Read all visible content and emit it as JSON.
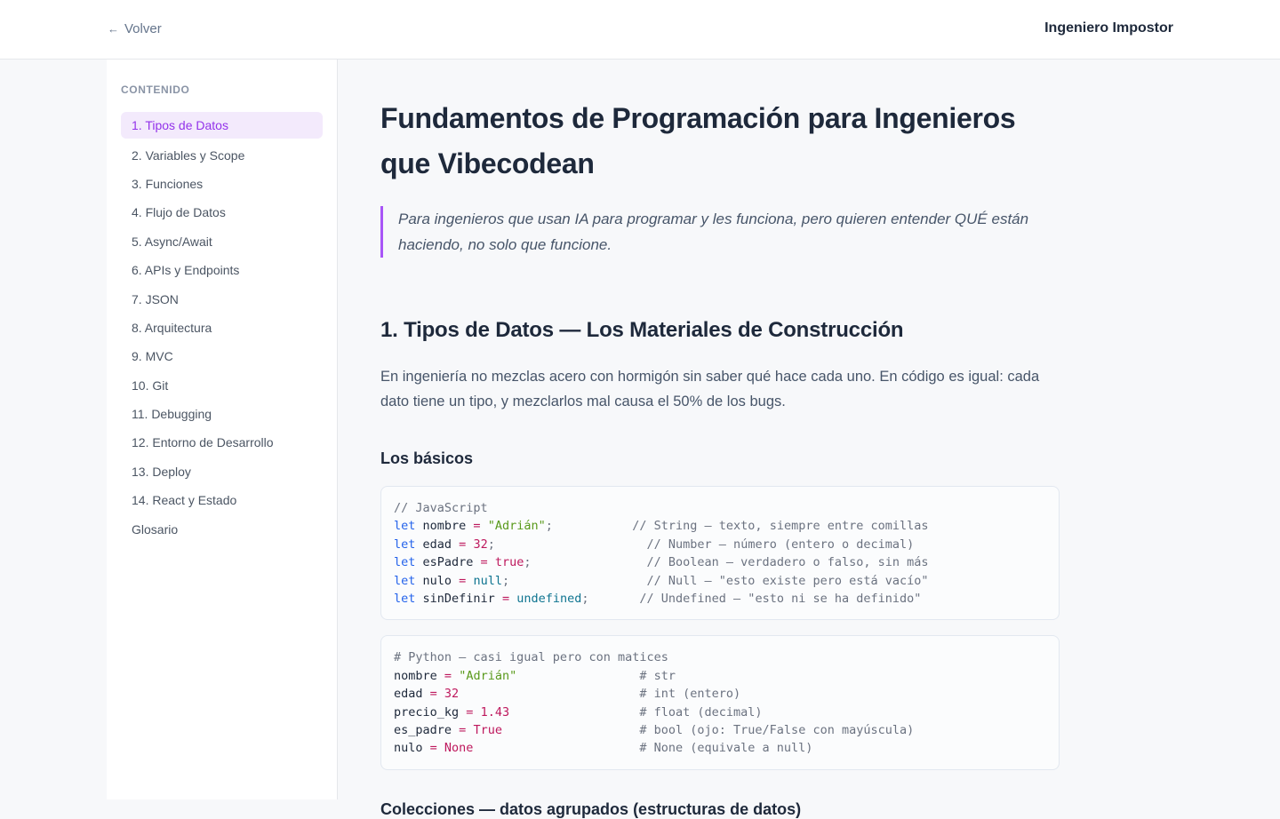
{
  "header": {
    "back_label": "Volver",
    "brand": "Ingeniero Impostor"
  },
  "sidebar": {
    "heading": "CONTENIDO",
    "items": [
      {
        "label": "1. Tipos de Datos",
        "active": true
      },
      {
        "label": "2. Variables y Scope"
      },
      {
        "label": "3. Funciones"
      },
      {
        "label": "4. Flujo de Datos"
      },
      {
        "label": "5. Async/Await"
      },
      {
        "label": "6. APIs y Endpoints"
      },
      {
        "label": "7. JSON"
      },
      {
        "label": "8. Arquitectura"
      },
      {
        "label": "9. MVC"
      },
      {
        "label": "10. Git"
      },
      {
        "label": "11. Debugging"
      },
      {
        "label": "12. Entorno de Desarrollo"
      },
      {
        "label": "13. Deploy"
      },
      {
        "label": "14. React y Estado"
      },
      {
        "label": "Glosario"
      }
    ]
  },
  "main": {
    "title": "Fundamentos de Programación para Ingenieros que Vibecodean",
    "lead": "Para ingenieros que usan IA para programar y les funciona, pero quieren entender QUÉ están haciendo, no solo que funcione.",
    "section_title": "1. Tipos de Datos — Los Materiales de Construcción",
    "section_intro": "En ingeniería no mezclas acero con hormigón sin saber qué hace cada uno. En código es igual: cada dato tiene un tipo, y mezclarlos mal causa el 50% de los bugs.",
    "subsection_title": "Los básicos",
    "code_js": [
      {
        "tokens": [
          {
            "t": "c",
            "v": "// JavaScript"
          }
        ]
      },
      {
        "tokens": [
          {
            "t": "k",
            "v": "let"
          },
          {
            "t": "p",
            "v": " nombre "
          },
          {
            "t": "n",
            "v": "="
          },
          {
            "t": "p",
            "v": " "
          },
          {
            "t": "s",
            "v": "\"Adrián\""
          },
          {
            "t": "c",
            "v": ";           // String — texto, siempre entre comillas"
          }
        ]
      },
      {
        "tokens": [
          {
            "t": "k",
            "v": "let"
          },
          {
            "t": "p",
            "v": " edad "
          },
          {
            "t": "n",
            "v": "="
          },
          {
            "t": "p",
            "v": " "
          },
          {
            "t": "n",
            "v": "32"
          },
          {
            "t": "c",
            "v": ";                     // Number — número (entero o decimal)"
          }
        ]
      },
      {
        "tokens": [
          {
            "t": "k",
            "v": "let"
          },
          {
            "t": "p",
            "v": " esPadre "
          },
          {
            "t": "n",
            "v": "="
          },
          {
            "t": "p",
            "v": " "
          },
          {
            "t": "n",
            "v": "true"
          },
          {
            "t": "c",
            "v": ";                // Boolean — verdadero o falso, sin más"
          }
        ]
      },
      {
        "tokens": [
          {
            "t": "k",
            "v": "let"
          },
          {
            "t": "p",
            "v": " nulo "
          },
          {
            "t": "n",
            "v": "="
          },
          {
            "t": "p",
            "v": " "
          },
          {
            "t": "v",
            "v": "null"
          },
          {
            "t": "c",
            "v": ";                   // Null — \"esto existe pero está vacío\""
          }
        ]
      },
      {
        "tokens": [
          {
            "t": "k",
            "v": "let"
          },
          {
            "t": "p",
            "v": " sinDefinir "
          },
          {
            "t": "n",
            "v": "="
          },
          {
            "t": "p",
            "v": " "
          },
          {
            "t": "v",
            "v": "undefined"
          },
          {
            "t": "c",
            "v": ";       // Undefined — \"esto ni se ha definido\""
          }
        ]
      }
    ],
    "code_py": [
      {
        "tokens": [
          {
            "t": "c",
            "v": "# Python — casi igual pero con matices"
          }
        ]
      },
      {
        "tokens": [
          {
            "t": "p",
            "v": "nombre "
          },
          {
            "t": "n",
            "v": "="
          },
          {
            "t": "p",
            "v": " "
          },
          {
            "t": "s",
            "v": "\"Adrián\""
          },
          {
            "t": "c",
            "v": "                 # str"
          }
        ]
      },
      {
        "tokens": [
          {
            "t": "p",
            "v": "edad "
          },
          {
            "t": "n",
            "v": "="
          },
          {
            "t": "p",
            "v": " "
          },
          {
            "t": "n",
            "v": "32"
          },
          {
            "t": "c",
            "v": "                         # int (entero)"
          }
        ]
      },
      {
        "tokens": [
          {
            "t": "p",
            "v": "precio_kg "
          },
          {
            "t": "n",
            "v": "="
          },
          {
            "t": "p",
            "v": " "
          },
          {
            "t": "n",
            "v": "1.43"
          },
          {
            "t": "c",
            "v": "                  # float (decimal)"
          }
        ]
      },
      {
        "tokens": [
          {
            "t": "p",
            "v": "es_padre "
          },
          {
            "t": "n",
            "v": "="
          },
          {
            "t": "p",
            "v": " "
          },
          {
            "t": "n",
            "v": "True"
          },
          {
            "t": "c",
            "v": "                   # bool (ojo: True/False con mayúscula)"
          }
        ]
      },
      {
        "tokens": [
          {
            "t": "p",
            "v": "nulo "
          },
          {
            "t": "n",
            "v": "="
          },
          {
            "t": "p",
            "v": " "
          },
          {
            "t": "n",
            "v": "None"
          },
          {
            "t": "c",
            "v": "                       # None (equivale a null)"
          }
        ]
      }
    ],
    "next_heading": "Colecciones — datos agrupados (estructuras de datos)"
  }
}
